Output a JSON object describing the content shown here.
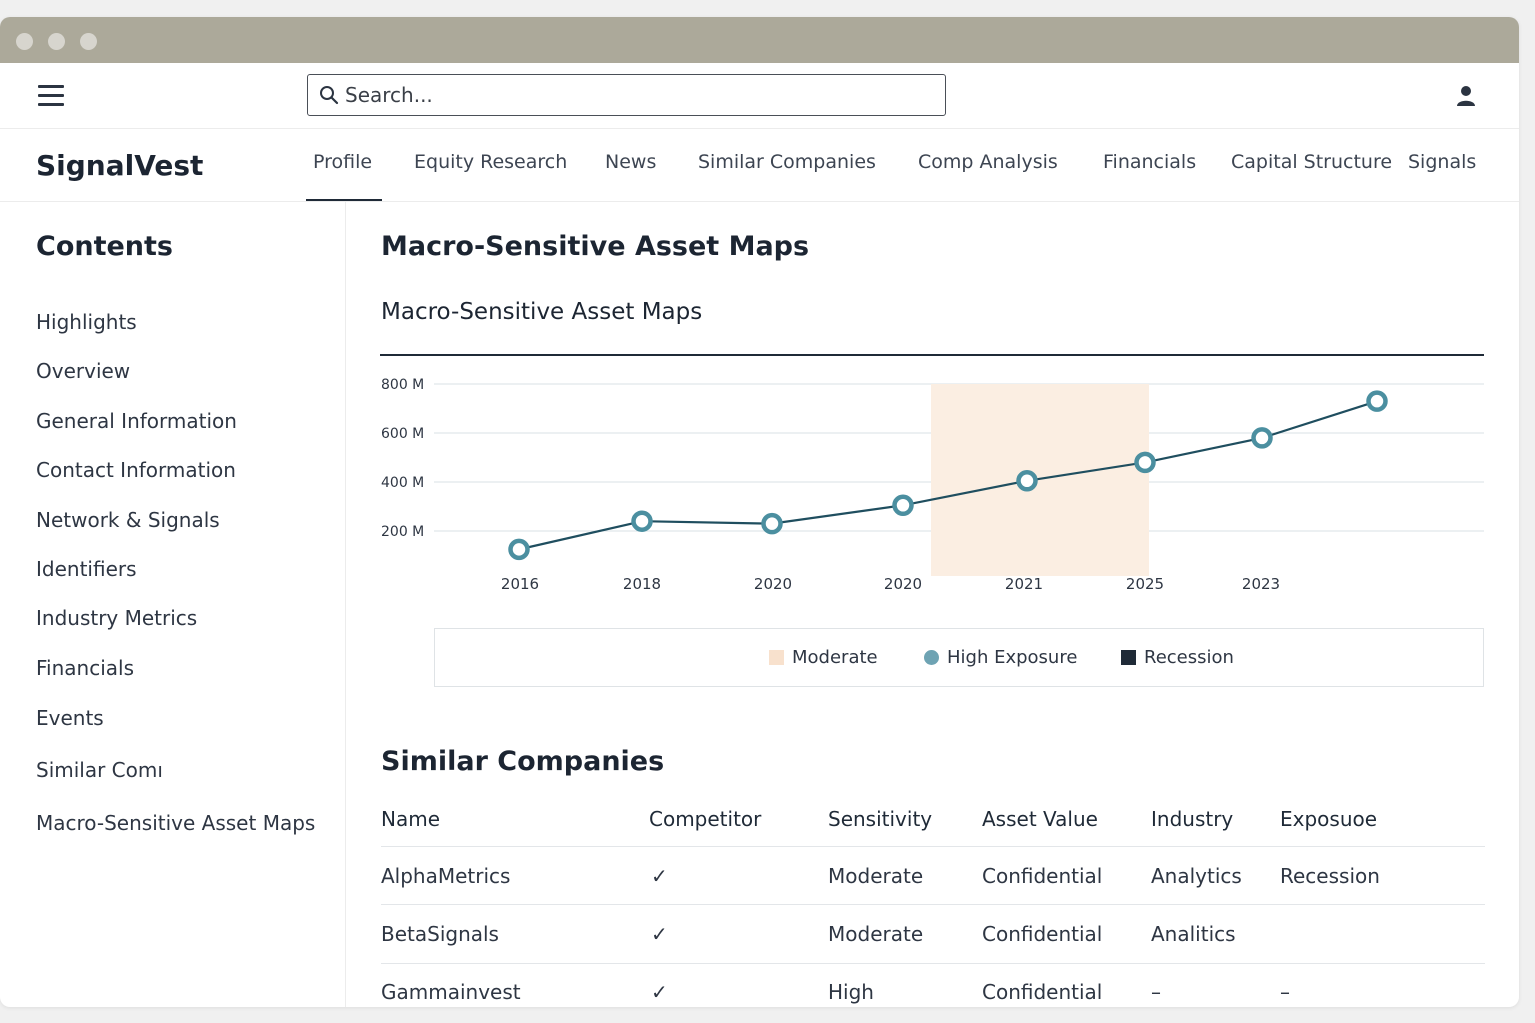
{
  "search": {
    "placeholder": "Search..."
  },
  "brand": "SignalVest",
  "tabs": [
    {
      "label": "Profile"
    },
    {
      "label": "Equity Research"
    },
    {
      "label": "News"
    },
    {
      "label": "Similar Companies"
    },
    {
      "label": "Comp Analysis"
    },
    {
      "label": "Financials"
    },
    {
      "label": "Capital Structure"
    },
    {
      "label": "Signals"
    }
  ],
  "active_tab": "Profile",
  "sidebar": {
    "title": "Contents",
    "items": [
      "Highlights",
      "Overview",
      "General Information",
      "Contact Information",
      "Network & Signals",
      "Identifiers",
      "Industry Metrics",
      "Financials",
      "Events",
      "Similar Comı",
      "Macro-Sensitive Asset Maps"
    ]
  },
  "main": {
    "page_title": "Macro-Sensitive Asset Maps",
    "chart_title": "Macro-Sensitive Asset Maps"
  },
  "chart_data": {
    "type": "line",
    "title": "Macro-Sensitive Asset Maps",
    "xlabel": "",
    "ylabel": "",
    "x_tick_labels": [
      "2016",
      "2018",
      "2020",
      "2020",
      "2021",
      "2025",
      "2023"
    ],
    "y_tick_labels": [
      "800 M",
      "600 M",
      "400 M",
      "200 M"
    ],
    "y_ticks": [
      800,
      600,
      400,
      200
    ],
    "ylim": [
      0,
      800
    ],
    "grid": true,
    "series": [
      {
        "values": [
          125,
          240,
          230,
          305,
          405,
          480,
          580,
          730
        ]
      }
    ],
    "shaded_region": {
      "from_index": 3.2,
      "to_index": 5.0,
      "color": "#fbeee2"
    },
    "line_color": "#1f4e5f",
    "marker_color": "#4b8fa0",
    "legend": [
      {
        "label": "Moderate",
        "color": "#f8e1cd",
        "shape": "square"
      },
      {
        "label": "High Exposure",
        "color": "#6ea3b3",
        "shape": "circle"
      },
      {
        "label": "Recession",
        "color": "#1f2a37",
        "shape": "square"
      }
    ],
    "legend_position": "bottom"
  },
  "similar": {
    "title": "Similar Companies",
    "columns": [
      "Name",
      "Competitor",
      "Sensitivity",
      "Asset Value",
      "Industry",
      "Exposuoe"
    ],
    "rows": [
      [
        "AlphaMetrics",
        "✓",
        "Moderate",
        "Confidential",
        "Analytics",
        "Recession"
      ],
      [
        "BetaSignals",
        "✓",
        "Moderate",
        "Confidential",
        "Analitics",
        ""
      ],
      [
        "Gammainvest",
        "✓",
        "High",
        "Confidential",
        "–",
        "–"
      ]
    ]
  }
}
